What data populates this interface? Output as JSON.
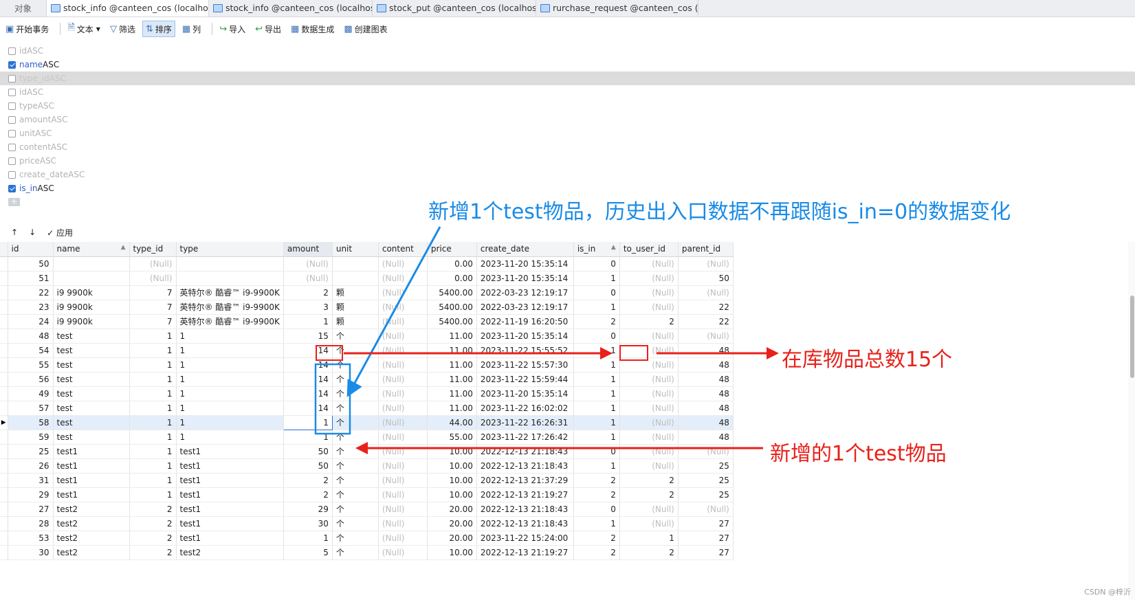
{
  "tabs": [
    {
      "label": "对象"
    },
    {
      "label": "stock_info @canteen_cos (localhost) ..."
    },
    {
      "label": "stock_info @canteen_cos (localhost) ..."
    },
    {
      "label": "stock_put @canteen_cos (localhost) ..."
    },
    {
      "label": "rurchase_request @canteen_cos (loc..."
    }
  ],
  "toolbar": {
    "begin_tx": "开始事务",
    "text": "文本",
    "filter": "筛选",
    "sort": "排序",
    "columns": "列",
    "import": "导入",
    "export": "导出",
    "datagen": "数据生成",
    "chart": "创建图表"
  },
  "sort_fields": [
    {
      "field": "id",
      "order": "ASC",
      "checked": false
    },
    {
      "field": "name",
      "order": "ASC",
      "checked": true
    },
    {
      "field": "type_id",
      "order": "ASC",
      "checked": false
    },
    {
      "field": "id",
      "order": "ASC",
      "checked": false
    },
    {
      "field": "type",
      "order": "ASC",
      "checked": false
    },
    {
      "field": "amount",
      "order": "ASC",
      "checked": false
    },
    {
      "field": "unit",
      "order": "ASC",
      "checked": false
    },
    {
      "field": "content",
      "order": "ASC",
      "checked": false
    },
    {
      "field": "price",
      "order": "ASC",
      "checked": false
    },
    {
      "field": "create_date",
      "order": "ASC",
      "checked": false
    },
    {
      "field": "is_in",
      "order": "ASC",
      "checked": true
    }
  ],
  "sort_add": "+",
  "apply_bar": {
    "up": "↑",
    "down": "↓",
    "apply": "✓ 应用"
  },
  "columns": [
    "id",
    "name",
    "type_id",
    "type",
    "amount",
    "unit",
    "content",
    "price",
    "create_date",
    "is_in",
    "to_user_id",
    "parent_id"
  ],
  "rows": [
    [
      "50",
      "",
      "(Null)",
      "",
      "(Null)",
      "",
      "(Null)",
      "0.00",
      "2023-11-20 15:35:14",
      "0",
      "(Null)",
      "(Null)"
    ],
    [
      "51",
      "",
      "(Null)",
      "",
      "(Null)",
      "",
      "(Null)",
      "0.00",
      "2023-11-20 15:35:14",
      "1",
      "(Null)",
      "50"
    ],
    [
      "22",
      "i9 9900k",
      "7",
      "英特尔® 酷睿™ i9-9900K",
      "2",
      "颗",
      "(Null)",
      "5400.00",
      "2022-03-23 12:19:17",
      "0",
      "(Null)",
      "(Null)"
    ],
    [
      "23",
      "i9 9900k",
      "7",
      "英特尔® 酷睿™ i9-9900K",
      "3",
      "颗",
      "(Null)",
      "5400.00",
      "2022-03-23 12:19:17",
      "1",
      "(Null)",
      "22"
    ],
    [
      "24",
      "i9 9900k",
      "7",
      "英特尔® 酷睿™ i9-9900K",
      "1",
      "颗",
      "(Null)",
      "5400.00",
      "2022-11-19 16:20:50",
      "2",
      "2",
      "22"
    ],
    [
      "48",
      "test",
      "1",
      "1",
      "15",
      "个",
      "(Null)",
      "11.00",
      "2023-11-20 15:35:14",
      "0",
      "(Null)",
      "(Null)"
    ],
    [
      "54",
      "test",
      "1",
      "1",
      "14",
      "个",
      "(Null)",
      "11.00",
      "2023-11-22 15:55:52",
      "1",
      "(Null)",
      "48"
    ],
    [
      "55",
      "test",
      "1",
      "1",
      "14",
      "个",
      "(Null)",
      "11.00",
      "2023-11-22 15:57:30",
      "1",
      "(Null)",
      "48"
    ],
    [
      "56",
      "test",
      "1",
      "1",
      "14",
      "个",
      "(Null)",
      "11.00",
      "2023-11-22 15:59:44",
      "1",
      "(Null)",
      "48"
    ],
    [
      "49",
      "test",
      "1",
      "1",
      "14",
      "个",
      "(Null)",
      "11.00",
      "2023-11-20 15:35:14",
      "1",
      "(Null)",
      "48"
    ],
    [
      "57",
      "test",
      "1",
      "1",
      "14",
      "个",
      "(Null)",
      "11.00",
      "2023-11-22 16:02:02",
      "1",
      "(Null)",
      "48"
    ],
    [
      "58",
      "test",
      "1",
      "1",
      "1",
      "个",
      "(Null)",
      "44.00",
      "2023-11-22 16:26:31",
      "1",
      "(Null)",
      "48"
    ],
    [
      "59",
      "test",
      "1",
      "1",
      "1",
      "个",
      "(Null)",
      "55.00",
      "2023-11-22 17:26:42",
      "1",
      "(Null)",
      "48"
    ],
    [
      "25",
      "test1",
      "1",
      "test1",
      "50",
      "个",
      "(Null)",
      "10.00",
      "2022-12-13 21:18:43",
      "0",
      "(Null)",
      "(Null)"
    ],
    [
      "26",
      "test1",
      "1",
      "test1",
      "50",
      "个",
      "(Null)",
      "10.00",
      "2022-12-13 21:18:43",
      "1",
      "(Null)",
      "25"
    ],
    [
      "31",
      "test1",
      "1",
      "test1",
      "2",
      "个",
      "(Null)",
      "10.00",
      "2022-12-13 21:37:29",
      "2",
      "2",
      "25"
    ],
    [
      "29",
      "test1",
      "1",
      "test1",
      "2",
      "个",
      "(Null)",
      "10.00",
      "2022-12-13 21:19:27",
      "2",
      "2",
      "25"
    ],
    [
      "27",
      "test2",
      "2",
      "test1",
      "29",
      "个",
      "(Null)",
      "20.00",
      "2022-12-13 21:18:43",
      "0",
      "(Null)",
      "(Null)"
    ],
    [
      "28",
      "test2",
      "2",
      "test1",
      "30",
      "个",
      "(Null)",
      "20.00",
      "2022-12-13 21:18:43",
      "1",
      "(Null)",
      "27"
    ],
    [
      "53",
      "test2",
      "2",
      "test1",
      "1",
      "个",
      "(Null)",
      "20.00",
      "2023-11-22 15:24:00",
      "2",
      "1",
      "27"
    ],
    [
      "30",
      "test2",
      "2",
      "test2",
      "5",
      "个",
      "(Null)",
      "10.00",
      "2022-12-13 21:19:27",
      "2",
      "2",
      "27"
    ]
  ],
  "current_row_index": 11,
  "annotations": {
    "top_note": "新增1个test物品，历史出入口数据不再跟随is_in=0的数据变化",
    "stock_total": "在库物品总数15个",
    "new_item": "新增的1个test物品"
  },
  "colors": {
    "annotation_blue": "#1a8be6",
    "annotation_red": "#e8211a",
    "selection": "#2b6fd6"
  },
  "watermark": "CSDN @梓沂"
}
